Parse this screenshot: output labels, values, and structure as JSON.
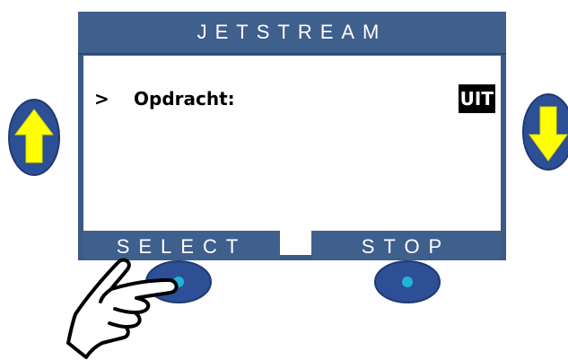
{
  "panel": {
    "title": "JETSTREAM",
    "menu_row": {
      "cursor": ">",
      "label": "Opdracht:",
      "value": "UIT"
    },
    "softkeys": {
      "left_label": "SELECT",
      "right_label": "STOP"
    }
  },
  "icons": {
    "left_arrow": "arrow-up-icon",
    "right_arrow": "arrow-down-icon",
    "hand": "pointing-hand-icon"
  },
  "colors": {
    "screen_frame": "#3b5a86",
    "button_blue": "#2d4f95",
    "arrow_yellow": "#ffff00",
    "led_cyan": "#1fb5d6"
  }
}
